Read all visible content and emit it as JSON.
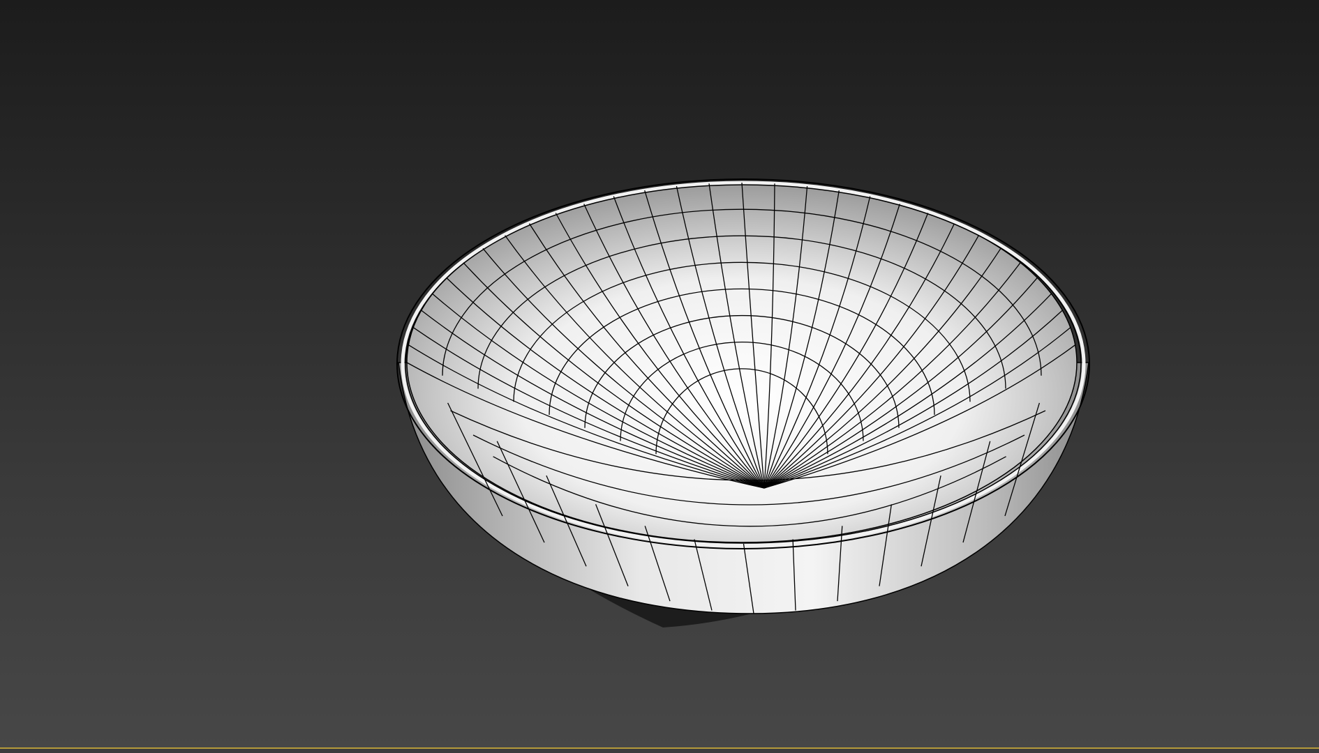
{
  "viewport": {
    "border_color": "#b59a3a",
    "background_top": "#1c1c1c",
    "background_bottom": "#474747"
  },
  "model": {
    "object_icon": "bowl-mesh-icon",
    "display_mode": "shaded-with-edged-faces",
    "wire_color": "#000000",
    "surface_color": "#e8e8e8"
  }
}
